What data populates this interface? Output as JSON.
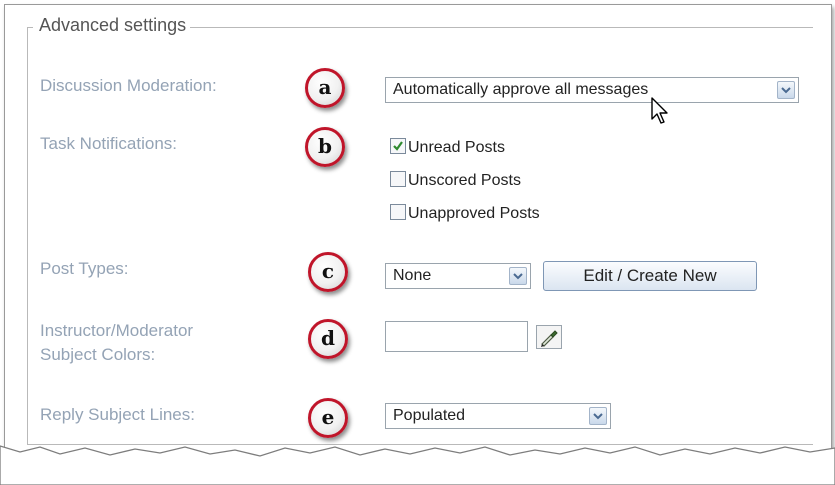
{
  "group_title": "Advanced settings",
  "rows": {
    "moderation": {
      "label": "Discussion Moderation:",
      "badge": "a",
      "selected": "Automatically approve all messages"
    },
    "notifications": {
      "label": "Task Notifications:",
      "badge": "b",
      "options": [
        {
          "label": "Unread Posts",
          "checked": true
        },
        {
          "label": "Unscored Posts",
          "checked": false
        },
        {
          "label": "Unapproved Posts",
          "checked": false
        }
      ]
    },
    "post_types": {
      "label": "Post Types:",
      "badge": "c",
      "selected": "None",
      "button": "Edit / Create New"
    },
    "colors": {
      "label_line1": "Instructor/Moderator",
      "label_line2": "Subject Colors:",
      "badge": "d",
      "value": ""
    },
    "reply": {
      "label": "Reply Subject Lines:",
      "badge": "e",
      "selected": "Populated"
    }
  },
  "icons": [
    "chevron-down-icon",
    "checkmark-icon",
    "color-picker-icon",
    "mouse-cursor-icon"
  ],
  "colors": {
    "label": "#94a3b5",
    "badge_ring": "#c0152a",
    "button_border": "#7f97b5"
  }
}
